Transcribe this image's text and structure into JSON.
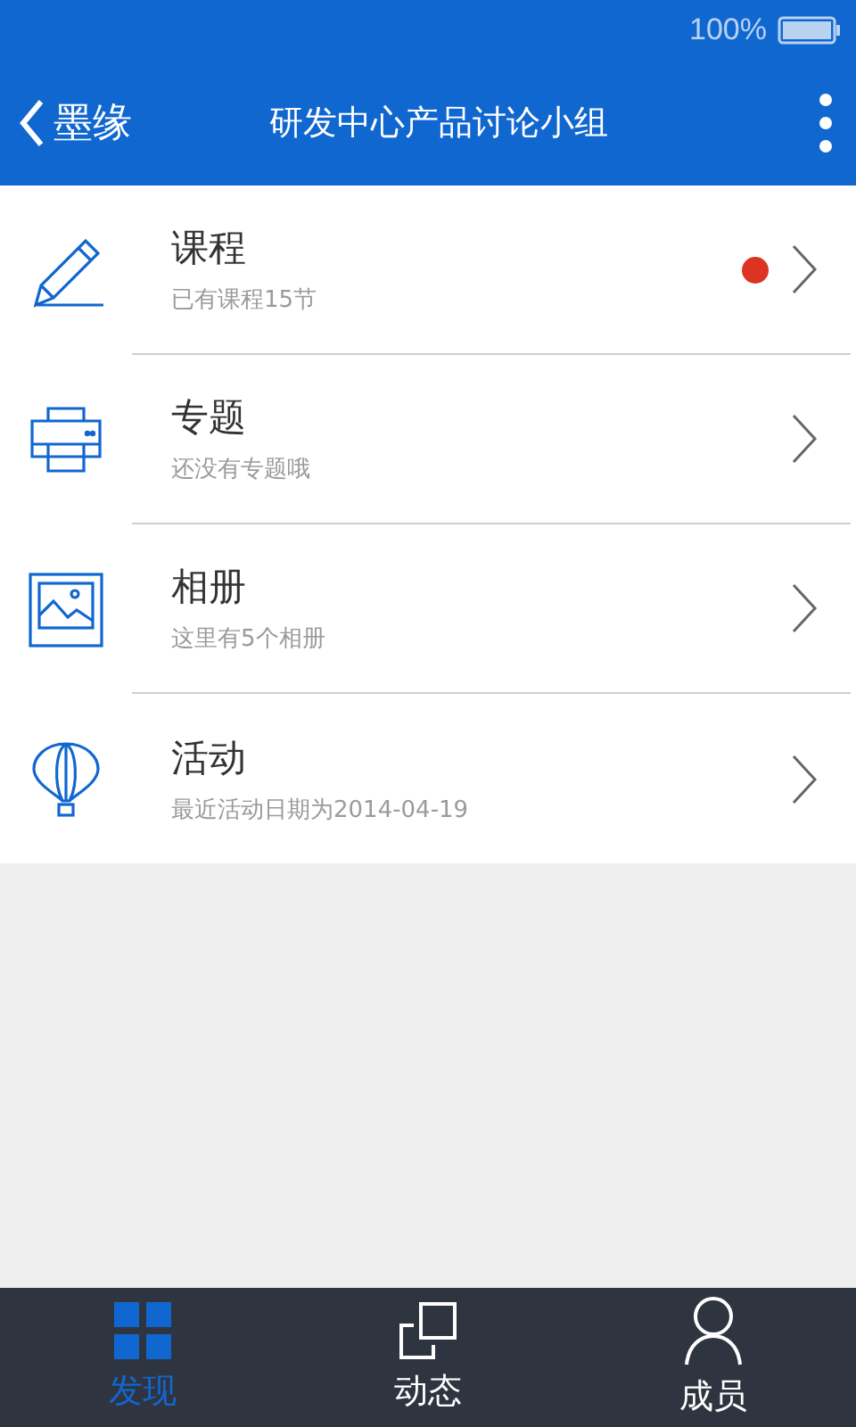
{
  "status_bar": {
    "battery": "100%"
  },
  "header": {
    "back_label": "墨缘",
    "title": "研发中心产品讨论小组"
  },
  "items": [
    {
      "kind": "pencil",
      "title": "课程",
      "subtitle": "已有课程15节",
      "unread": true
    },
    {
      "kind": "printer",
      "title": "专题",
      "subtitle": "还没有专题哦",
      "unread": false
    },
    {
      "kind": "image",
      "title": "相册",
      "subtitle": "这里有5个相册",
      "unread": false
    },
    {
      "kind": "balloon",
      "title": "活动",
      "subtitle": "最近活动日期为2014-04-19",
      "unread": false
    }
  ],
  "tabs": [
    {
      "kind": "grid",
      "label": "发现",
      "selected": true
    },
    {
      "kind": "squares",
      "label": "动态",
      "selected": false
    },
    {
      "kind": "person",
      "label": "成员",
      "selected": false
    }
  ]
}
